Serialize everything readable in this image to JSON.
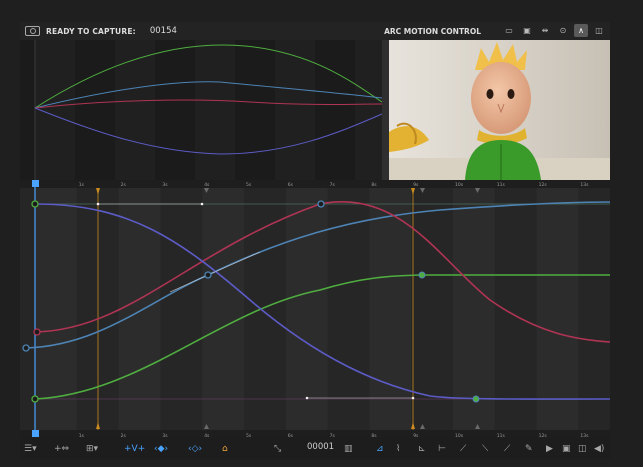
{
  "topbar": {
    "status": "READY TO CAPTURE:",
    "frame": "00154",
    "brand": "ARC MOTION CONTROL",
    "icons": [
      "monitor-icon",
      "screen-icon",
      "split-icon",
      "record-icon",
      "curve-icon",
      "layers-icon"
    ],
    "active_icon": "curve-icon"
  },
  "timeline": {
    "ticks": [
      "1s",
      "2s",
      "3s",
      "4s",
      "5s",
      "6s",
      "7s",
      "8s",
      "9s",
      "10s",
      "11s",
      "12s",
      "13s"
    ]
  },
  "bottombar": {
    "frame_value": "00001",
    "icons": [
      "menu-icon",
      "add-key-icon",
      "snap-icon",
      "vertical-arrows-icon",
      "prev-next-key-icon",
      "move-keys-icon",
      "lock-icon",
      "curve-scale-icon",
      "frame-counter",
      "linear-tangent-icon",
      "ease-icon",
      "step-icon",
      "flat-icon",
      "play-icon",
      "view-icon",
      "fullscreen-icon",
      "volume-icon"
    ]
  },
  "colors": {
    "green": "#4fae3f",
    "blue": "#4d84b5",
    "red": "#b03454",
    "purple": "#6060c8",
    "accent": "#4aa3ff",
    "keyframe_line": "#c98a1e"
  }
}
